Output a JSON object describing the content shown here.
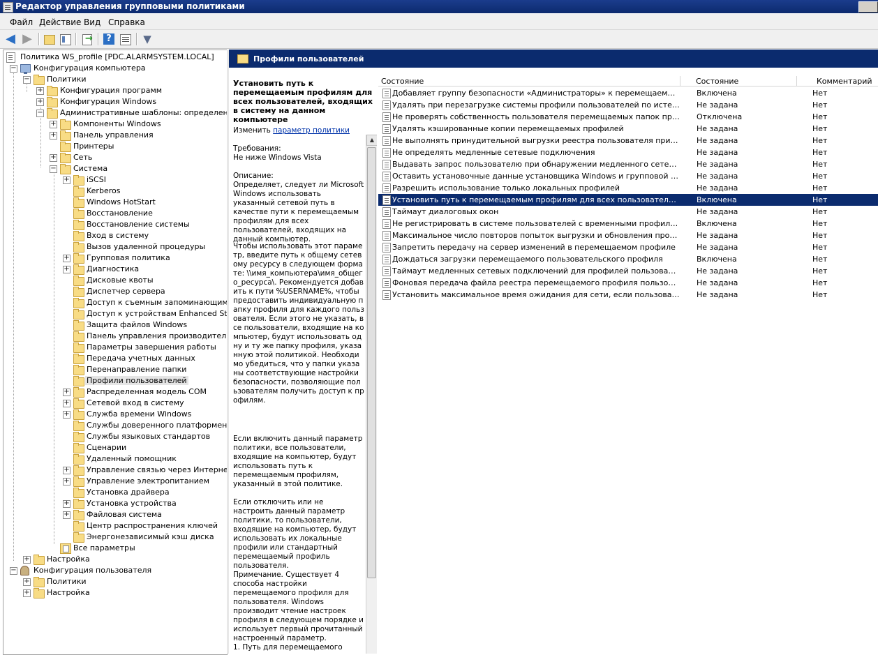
{
  "window": {
    "title": "Редактор управления групповыми политиками"
  },
  "menu": [
    "Файл",
    "Действие",
    "Вид",
    "Справка"
  ],
  "tree": [
    {
      "label": "Политика WS_profile [PDC.ALARMSYSTEM.LOCAL]",
      "icon": "doc"
    },
    {
      "label": "Конфигурация компьютера",
      "icon": "comp"
    },
    {
      "label": "Политики",
      "icon": "folder"
    },
    {
      "label": "Конфигурация программ",
      "icon": "folder"
    },
    {
      "label": "Конфигурация Windows",
      "icon": "folder"
    },
    {
      "label": "Административные шаблоны: определения по",
      "icon": "folder"
    },
    {
      "label": "Компоненты Windows",
      "icon": "folder"
    },
    {
      "label": "Панель управления",
      "icon": "folder"
    },
    {
      "label": "Принтеры",
      "icon": "folder"
    },
    {
      "label": "Сеть",
      "icon": "folder"
    },
    {
      "label": "Система",
      "icon": "folder"
    },
    {
      "label": "iSCSI",
      "icon": "folder"
    },
    {
      "label": "Kerberos",
      "icon": "folder"
    },
    {
      "label": "Windows HotStart",
      "icon": "folder"
    },
    {
      "label": "Восстановление",
      "icon": "folder"
    },
    {
      "label": "Восстановление системы",
      "icon": "folder"
    },
    {
      "label": "Вход в систему",
      "icon": "folder"
    },
    {
      "label": "Вызов удаленной процедуры",
      "icon": "folder"
    },
    {
      "label": "Групповая политика",
      "icon": "folder"
    },
    {
      "label": "Диагностика",
      "icon": "folder"
    },
    {
      "label": "Дисковые квоты",
      "icon": "folder"
    },
    {
      "label": "Диспетчер сервера",
      "icon": "folder"
    },
    {
      "label": "Доступ к съемным запоминающим устр",
      "icon": "folder"
    },
    {
      "label": "Доступ к устройствам Enhanced Storag",
      "icon": "folder"
    },
    {
      "label": "Защита файлов Windows",
      "icon": "folder"
    },
    {
      "label": "Панель управления производительнос",
      "icon": "folder"
    },
    {
      "label": "Параметры завершения работы",
      "icon": "folder"
    },
    {
      "label": "Передача учетных данных",
      "icon": "folder"
    },
    {
      "label": "Перенаправление папки",
      "icon": "folder"
    },
    {
      "label": "Профили пользователей",
      "icon": "folder"
    },
    {
      "label": "Распределенная модель COM",
      "icon": "folder"
    },
    {
      "label": "Сетевой вход в систему",
      "icon": "folder"
    },
    {
      "label": "Служба времени Windows",
      "icon": "folder"
    },
    {
      "label": "Службы доверенного платформенного",
      "icon": "folder"
    },
    {
      "label": "Службы языковых стандартов",
      "icon": "folder"
    },
    {
      "label": "Сценарии",
      "icon": "folder"
    },
    {
      "label": "Удаленный помощник",
      "icon": "folder"
    },
    {
      "label": "Управление связью через Интернет",
      "icon": "folder"
    },
    {
      "label": "Управление электропитанием",
      "icon": "folder"
    },
    {
      "label": "Установка драйвера",
      "icon": "folder"
    },
    {
      "label": "Установка устройства",
      "icon": "folder"
    },
    {
      "label": "Файловая система",
      "icon": "folder"
    },
    {
      "label": "Центр распространения ключей",
      "icon": "folder"
    },
    {
      "label": "Энергонезависимый кэш диска",
      "icon": "folder"
    },
    {
      "label": "Все параметры",
      "icon": "allset"
    },
    {
      "label": "Настройка",
      "icon": "folder"
    },
    {
      "label": "Конфигурация пользователя",
      "icon": "user"
    },
    {
      "label": "Политики",
      "icon": "folder"
    },
    {
      "label": "Настройка",
      "icon": "folder"
    }
  ],
  "right_header": "Профили пользователей",
  "description": {
    "title": "Установить путь к перемещаемым профилям для всех пользователей, входящих в систему на данном компьютере",
    "edit_prefix": "Изменить",
    "edit_link": "параметр политики",
    "req_label": "Требования:",
    "req_value": "Не ниже Windows Vista",
    "desc_label": "Описание:",
    "p1": "Определяет, следует ли Microsoft Windows использовать указанный сетевой путь в качестве пути к перемещаемым профилям для всех пользователей, входящих на данный компьютер.",
    "p2": "Чтобы использовать этот параметр, введите путь к общему сетевому ресурсу в следующем формате: \\\\имя_компьютера\\имя_общего_ресурса\\. Рекомендуется добавить к пути %USERNAME%, чтобы предоставить индивидуальную папку профиля для каждого пользователя. Если этого не указать, все пользователи, входящие на компьютер, будут использовать одну и ту же папку профиля, указанную этой политикой. Необходимо убедиться, что у папки указаны соответствующие настройки безопасности, позволяющие пользователям получить доступ к профилям.",
    "p3": "Если включить данный параметр политики, все пользователи, входящие на компьютер, будут использовать путь к перемещаемым профилям, указанный в этой политике.",
    "p4": "Если отключить или не настроить данный параметр политики, то пользователи, входящие на компьютер, будут использовать их локальные профили или стандартный перемещаемый профиль пользователя.",
    "p5": "Примечание. Существует 4 способа настройки перемещаемого профиля для пользователя. Windows производит чтение настроек профиля в следующем порядке и использует первый прочитанный настроенный параметр.",
    "p6": "1. Путь для перемещаемого"
  },
  "columns": {
    "name": "Состояние",
    "state": "Состояние",
    "comment": "Комментарий"
  },
  "rows": [
    {
      "name": "Добавляет группу безопасности «Администраторы» к перемещаемым профил...",
      "state": "Включена",
      "comment": "Нет"
    },
    {
      "name": "Удалять при перезагрузке системы профили пользователей по истечении ук...",
      "state": "Не задана",
      "comment": "Нет"
    },
    {
      "name": "Не проверять собственность пользователя перемещаемых папок профиля",
      "state": "Отключена",
      "comment": "Нет"
    },
    {
      "name": "Удалять кэшированные копии перемещаемых профилей",
      "state": "Не задана",
      "comment": "Нет"
    },
    {
      "name": "Не выполнять принудительной выгрузки реестра пользователя при его выхо...",
      "state": "Не задана",
      "comment": "Нет"
    },
    {
      "name": "Не определять медленные сетевые подключения",
      "state": "Не задана",
      "comment": "Нет"
    },
    {
      "name": "Выдавать запрос пользователю при обнаружении медленного сетевого подк...",
      "state": "Не задана",
      "comment": "Нет"
    },
    {
      "name": "Оставить установочные данные установщика Windows и групповой политики",
      "state": "Не задана",
      "comment": "Нет"
    },
    {
      "name": "Разрешить использование только локальных профилей",
      "state": "Не задана",
      "comment": "Нет"
    },
    {
      "name": "Установить путь к перемещаемым профилям для всех пользователей, входя...",
      "state": "Включена",
      "comment": "Нет",
      "selected": true
    },
    {
      "name": "Таймаут диалоговых окон",
      "state": "Не задана",
      "comment": "Нет"
    },
    {
      "name": "Не регистрировать в системе пользователей с временными профилями",
      "state": "Включена",
      "comment": "Нет"
    },
    {
      "name": "Максимальное число повторов попыток выгрузки и обновления профиля пол...",
      "state": "Не задана",
      "comment": "Нет"
    },
    {
      "name": "Запретить передачу на сервер изменений в перемещаемом профиле",
      "state": "Не задана",
      "comment": "Нет"
    },
    {
      "name": "Дождаться загрузки перемещаемого пользовательского профиля",
      "state": "Включена",
      "comment": "Нет"
    },
    {
      "name": "Таймаут медленных сетевых подключений для профилей пользователей",
      "state": "Не задана",
      "comment": "Нет"
    },
    {
      "name": "Фоновая передача файла реестра перемещаемого профиля пользователя пр...",
      "state": "Не задана",
      "comment": "Нет"
    },
    {
      "name": "Установить максимальное время ожидания для сети, если пользователь име...",
      "state": "Не задана",
      "comment": "Нет"
    }
  ]
}
